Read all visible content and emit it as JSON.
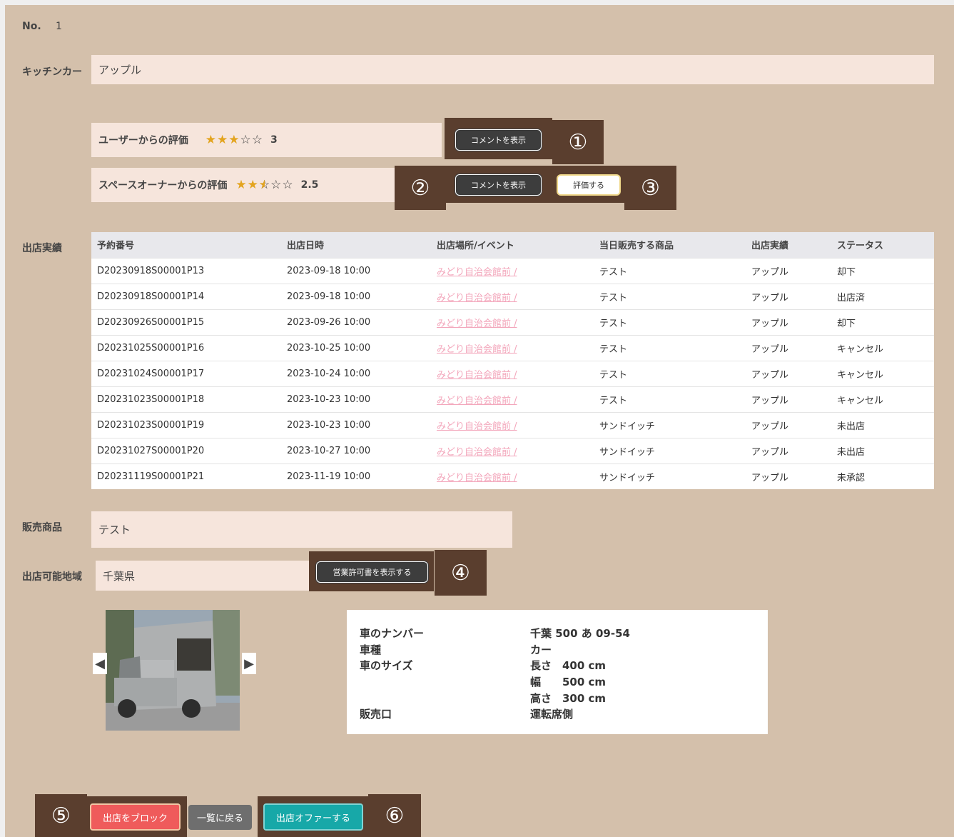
{
  "no": {
    "label": "No.",
    "value": "1"
  },
  "kitchen_car": {
    "label": "キッチンカー",
    "value": "アップル"
  },
  "ratings": {
    "user": {
      "label": "ユーザーからの評価",
      "score": "3",
      "stars": 3
    },
    "owner": {
      "label": "スペースオーナーからの評価",
      "score": "2.5",
      "stars": 2.5
    },
    "show_comment_label": "コメントを表示",
    "evaluate_label": "評価する"
  },
  "markers": {
    "m1": "①",
    "m2": "②",
    "m3": "③",
    "m4": "④",
    "m5": "⑤",
    "m6": "⑥"
  },
  "results": {
    "label": "出店実績",
    "headers": [
      "予約番号",
      "出店日時",
      "出店場所/イベント",
      "当日販売する商品",
      "出店実績",
      "ステータス"
    ],
    "rows": [
      [
        "D20230918S00001P13",
        "2023-09-18 10:00",
        "みどり自治会館前 /",
        "テスト",
        "アップル",
        "却下"
      ],
      [
        "D20230918S00001P14",
        "2023-09-18 10:00",
        "みどり自治会館前 /",
        "テスト",
        "アップル",
        "出店済"
      ],
      [
        "D20230926S00001P15",
        "2023-09-26 10:00",
        "みどり自治会館前 /",
        "テスト",
        "アップル",
        "却下"
      ],
      [
        "D20231025S00001P16",
        "2023-10-25 10:00",
        "みどり自治会館前 /",
        "テスト",
        "アップル",
        "キャンセル"
      ],
      [
        "D20231024S00001P17",
        "2023-10-24 10:00",
        "みどり自治会館前 /",
        "テスト",
        "アップル",
        "キャンセル"
      ],
      [
        "D20231023S00001P18",
        "2023-10-23 10:00",
        "みどり自治会館前 /",
        "テスト",
        "アップル",
        "キャンセル"
      ],
      [
        "D20231023S00001P19",
        "2023-10-23 10:00",
        "みどり自治会館前 /",
        "サンドイッチ",
        "アップル",
        "未出店"
      ],
      [
        "D20231027S00001P20",
        "2023-10-27 10:00",
        "みどり自治会館前 /",
        "サンドイッチ",
        "アップル",
        "未出店"
      ],
      [
        "D20231119S00001P21",
        "2023-11-19 10:00",
        "みどり自治会館前 /",
        "サンドイッチ",
        "アップル",
        "未承認"
      ]
    ]
  },
  "products": {
    "label": "販売商品",
    "value": "テスト"
  },
  "area": {
    "label": "出店可能地域",
    "value": "千葉県",
    "license_button": "営業許可書を表示する"
  },
  "vehicle": {
    "number_label": "車のナンバー",
    "number": "千葉 500 あ 09-54",
    "type_label": "車種",
    "type": "カー",
    "size_label": "車のサイズ",
    "length": "長さ　400 cm",
    "width": "幅　　500 cm",
    "height": "高さ　300 cm",
    "window_label": "販売口",
    "window": "運転席側"
  },
  "footer": {
    "block_label": "出店をブロック",
    "back_label": "一覧に戻る",
    "offer_label": "出店オファーする"
  }
}
